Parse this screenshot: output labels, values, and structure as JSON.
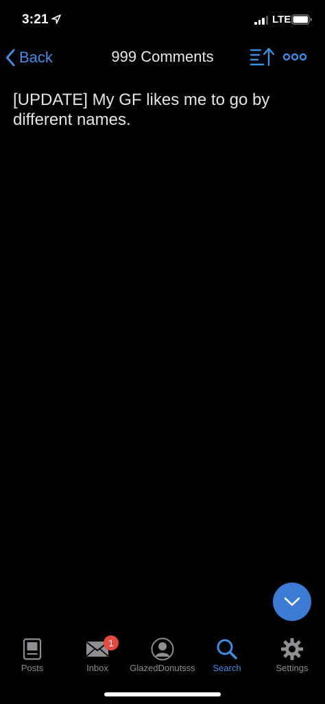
{
  "status": {
    "time": "3:21",
    "network": "LTE",
    "signal_bars": 3,
    "signal_bars_total": 4,
    "battery_level": 0.9,
    "icons": [
      "location-arrow-icon",
      "signal-icon",
      "battery-icon"
    ]
  },
  "nav": {
    "back_label": "Back",
    "title": "999 Comments",
    "icons": [
      "chevron-left-icon",
      "sort-icon",
      "more-icon"
    ]
  },
  "post": {
    "title": "[UPDATE] My GF likes me to go by different names."
  },
  "fab": {
    "icon": "chevron-down-icon"
  },
  "tabs": [
    {
      "label": "Posts",
      "icon": "posts-icon",
      "active": false
    },
    {
      "label": "Inbox",
      "icon": "envelope-icon",
      "active": false,
      "badge": "1"
    },
    {
      "label": "GlazedDonutsss",
      "icon": "user-icon",
      "active": false
    },
    {
      "label": "Search",
      "icon": "search-icon",
      "active": true
    },
    {
      "label": "Settings",
      "icon": "gear-icon",
      "active": false
    }
  ],
  "colors": {
    "background": "#000000",
    "accent": "#3f8fe8",
    "fab": "#3b7bd4",
    "badge": "#e8493f",
    "inactive": "#8e8e93"
  }
}
